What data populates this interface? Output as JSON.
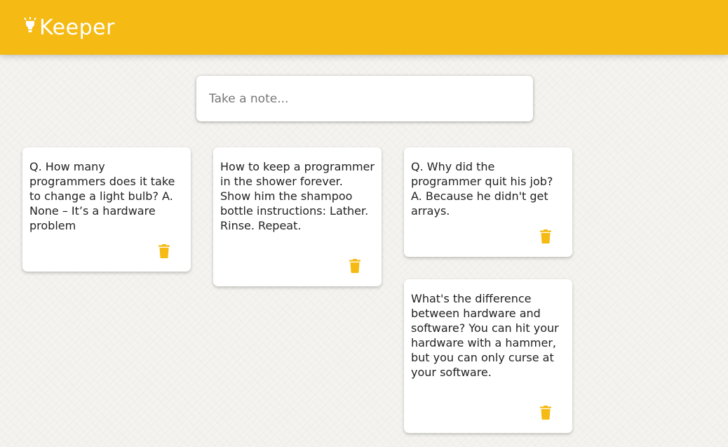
{
  "app": {
    "title": "Keeper",
    "accent_color": "#f5ba13",
    "logo_icon": "lightbulb-icon"
  },
  "create_note": {
    "placeholder": "Take a note..."
  },
  "notes": [
    {
      "content": "Q. How many programmers does it take to change a light bulb? A. None – It’s a hardware problem",
      "delete_icon": "trash-icon"
    },
    {
      "content": "How to keep a programmer in the shower forever. Show him the shampoo bottle instructions: Lather. Rinse. Repeat.",
      "delete_icon": "trash-icon"
    },
    {
      "content": "Q. Why did the programmer quit his job? A. Because he didn't get arrays.",
      "delete_icon": "trash-icon"
    },
    {
      "content": "What's the difference between hardware and software? You can hit your hardware with a hammer, but you can only curse at your software.",
      "delete_icon": "trash-icon"
    }
  ]
}
